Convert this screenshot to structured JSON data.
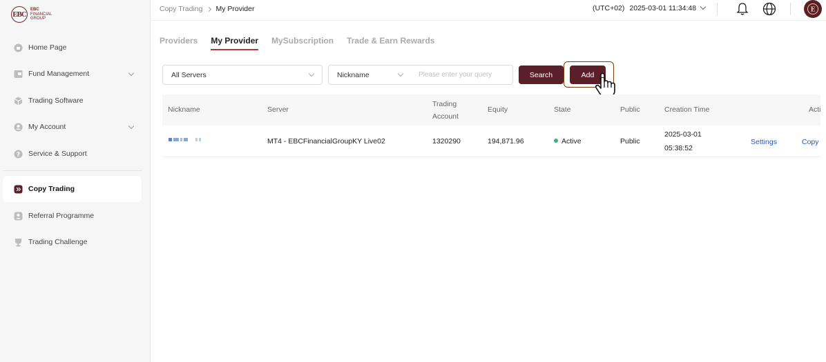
{
  "brand": {
    "logo_mark": "EBC",
    "logo_line1": "EBC",
    "logo_line2": "FINANCIAL",
    "logo_line3": "GROUP"
  },
  "sidebar": {
    "items": [
      {
        "label": "Home Page",
        "icon": "home-icon"
      },
      {
        "label": "Fund Management",
        "icon": "wallet-icon"
      },
      {
        "label": "Trading Software",
        "icon": "cube-icon"
      },
      {
        "label": "My Account",
        "icon": "user-icon"
      },
      {
        "label": "Service & Support",
        "icon": "help-icon"
      },
      {
        "label": "Copy Trading",
        "icon": "copy-trading-icon"
      },
      {
        "label": "Referral Programme",
        "icon": "referral-icon"
      },
      {
        "label": "Trading Challenge",
        "icon": "trophy-icon"
      }
    ]
  },
  "header": {
    "breadcrumb_parent": "Copy Trading",
    "breadcrumb_current": "My Provider",
    "timezone": "(UTC+02)",
    "datetime": "2025-03-01 11:34:48"
  },
  "tabs": [
    "Providers",
    "My Provider",
    "MySubscription",
    "Trade & Earn Rewards"
  ],
  "filters": {
    "server_select": "All Servers",
    "field_select": "Nickname",
    "query_placeholder": "Please enter your query",
    "search_label": "Search",
    "add_label": "Add"
  },
  "table": {
    "headers": {
      "nickname": "Nickname",
      "server": "Server",
      "trading_account_1": "Trading",
      "trading_account_2": "Account",
      "equity": "Equity",
      "state": "State",
      "public": "Public",
      "creation_time": "Creation Time",
      "action": "Acti"
    },
    "rows": [
      {
        "server": "MT4 - EBCFinancialGroupKY Live02",
        "trading_account": "1320290",
        "equity": "194,871.96",
        "state": "Active",
        "public": "Public",
        "creation_date": "2025-03-01",
        "creation_time": "05:38:52",
        "settings": "Settings",
        "copy": "Copy"
      }
    ]
  },
  "colors": {
    "brand": "#5a1f28",
    "active_status": "#3cb371",
    "link": "#2a55b8",
    "tab_underline": "#b23a3a"
  }
}
